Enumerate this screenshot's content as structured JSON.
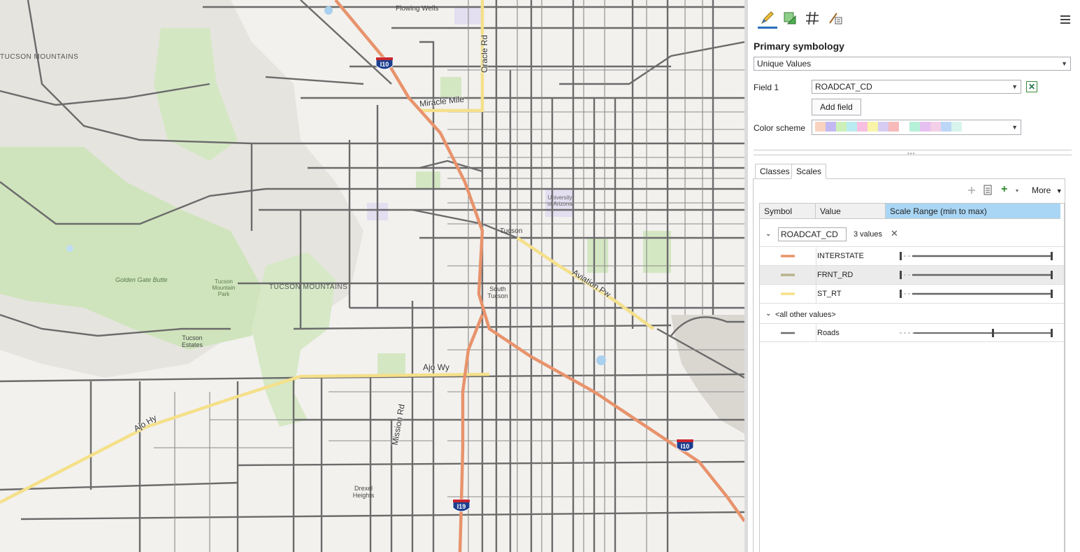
{
  "colors": {
    "interstate": "#e8936c",
    "frnt_rd": "#b8b48c",
    "st_rt": "#f5e08a",
    "roads": "#6b6b6b",
    "accent": "#2a6fbb",
    "scale_header": "#a9d6f5"
  },
  "map": {
    "labels": {
      "miracle_mile": "Miracle Mile",
      "oracle_rd": "Oracle Rd",
      "aviation_pw": "Aviation Pw",
      "ajo_wy": "Ajo Wy",
      "ajo_hy": "Ajo Hy",
      "mission_rd": "Mission Rd",
      "tucson_mountains_1": "TUCSON MOUNTAINS",
      "tucson_mountains_2": "TUCSON MOUNTAINS",
      "flowing_wells": "Flowing Wells",
      "tucson": "Tucson",
      "south_tucson": "South Tucson",
      "tucson_estates": "Tucson Estates",
      "drexel_heights": "Drexel Heights",
      "golden_gate_butte": "Golden Gate Butte",
      "tucson_mountain_park": "Tucson Mountain Park",
      "university_of_arizona": "University of Arizona",
      "i10_north": "I10",
      "i10_south": "I10",
      "i19": "I19"
    }
  },
  "panel": {
    "primary_symbology_label": "Primary symbology",
    "symbology_method": "Unique Values",
    "field1_label": "Field 1",
    "field1_value": "ROADCAT_CD",
    "add_field_label": "Add field",
    "color_scheme_label": "Color scheme",
    "color_scheme_colors": [
      "#f9d3c0",
      "#c2b9f2",
      "#cdf0b8",
      "#b9ecf0",
      "#f8bfe0",
      "#f8f5a8",
      "#d6ccf2",
      "#f8b9b9",
      "#ffffff",
      "#b7f0d8",
      "#e6c0f0",
      "#f3cfe8",
      "#bcd6f8",
      "#d8f4ec"
    ],
    "tabs": {
      "classes": "Classes",
      "scales": "Scales"
    },
    "toolbar": {
      "more_label": "More"
    },
    "grid": {
      "headers": {
        "symbol": "Symbol",
        "value": "Value",
        "scale_range": "Scale Range (min to max)"
      },
      "group_field": "ROADCAT_CD",
      "group_count": "3 values",
      "rows": [
        {
          "value": "INTERSTATE",
          "color": "#e8936c"
        },
        {
          "value": "FRNT_RD",
          "color": "#b8b48c"
        },
        {
          "value": "ST_RT",
          "color": "#f5e08a"
        }
      ],
      "other_label": "<all other values>",
      "other_row_value": "Roads",
      "other_row_color": "#6b6b6b"
    }
  }
}
